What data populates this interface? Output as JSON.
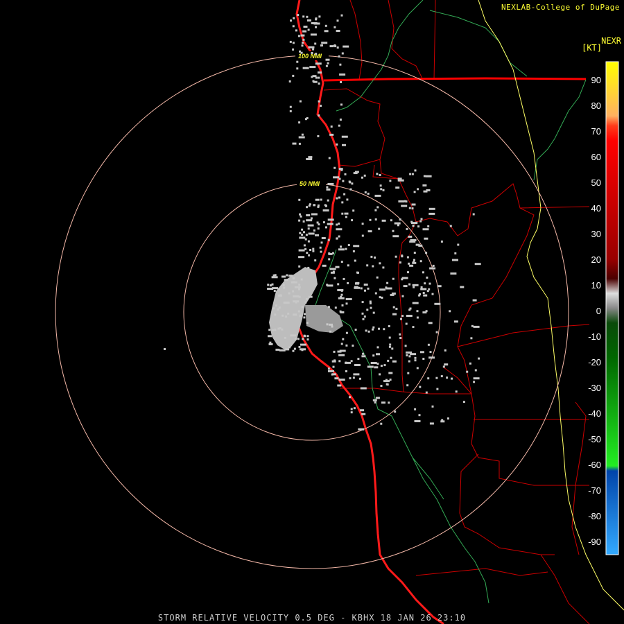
{
  "header": {
    "credit": "NEXLAB-College of DuPage",
    "product_code": "NEXR",
    "units": "[KT]"
  },
  "footer": {
    "caption": "STORM RELATIVE VELOCITY 0.5 DEG - KBHX 18 JAN 26 23:10"
  },
  "range_rings": [
    {
      "label": "50 NMI",
      "range_nmi": 50
    },
    {
      "label": "100 NMI",
      "range_nmi": 100
    }
  ],
  "color_scale": {
    "ticks": [
      90,
      80,
      70,
      60,
      50,
      40,
      30,
      20,
      10,
      0,
      -10,
      -20,
      -30,
      -40,
      -50,
      -60,
      -70,
      -80,
      -90
    ],
    "min": -100,
    "max": 100,
    "stops": [
      {
        "from": 70,
        "to": 100,
        "color": "#ffff00"
      },
      {
        "from": 70,
        "to": 80,
        "color": "#ff7f50"
      },
      {
        "from": 10,
        "to": 70,
        "color": "#ff0000"
      },
      {
        "from": 0,
        "to": 10,
        "color": "#b0b0b0"
      },
      {
        "from": -70,
        "to": -10,
        "color": "#00cc00"
      },
      {
        "from": -100,
        "to": -70,
        "color": "#3399ff"
      }
    ]
  },
  "colors": {
    "background": "#000000",
    "ring": "#f4b8a8",
    "ring_label": "#ffff33",
    "coast": "#ff1a1a",
    "county": "#cc0000",
    "river": "#33aa55",
    "interstate": "#ffff66",
    "echo": "#c8c8c8"
  }
}
